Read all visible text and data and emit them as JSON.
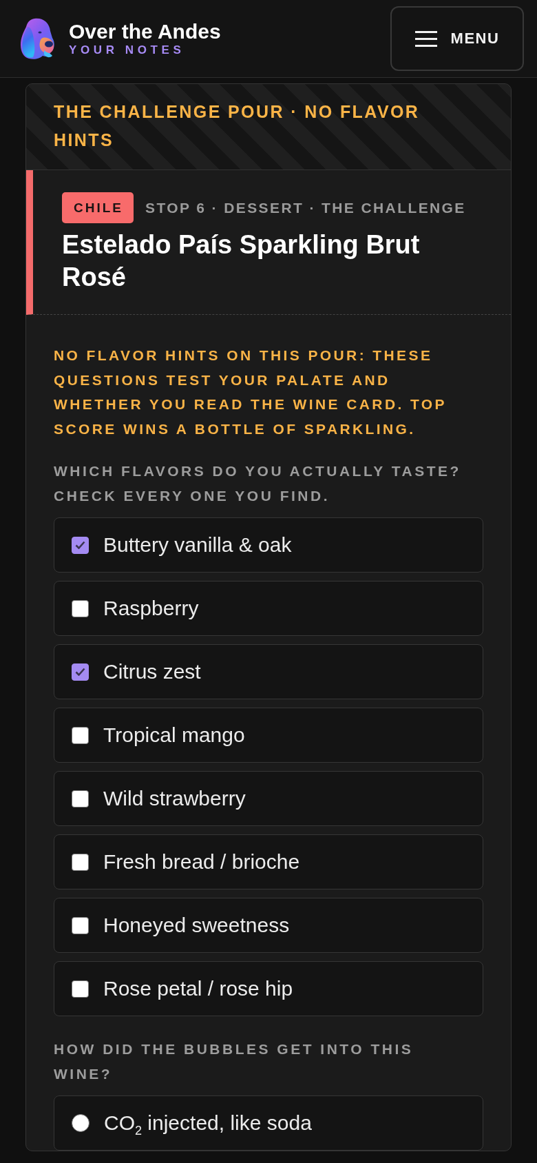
{
  "header": {
    "title": "Over the Andes",
    "subtitle": "YOUR NOTES",
    "menu_button": {
      "label": "MENU"
    }
  },
  "card": {
    "banner": "THE CHALLENGE POUR · NO FLAVOR HINTS",
    "wine": {
      "country": "CHILE",
      "meta": "STOP 6 · DESSERT · THE CHALLENGE",
      "name": "Estelado País Sparkling Brut Rosé"
    },
    "notice": "NO FLAVOR HINTS ON THIS POUR: THESE QUESTIONS TEST YOUR PALATE AND WHETHER YOU READ THE WINE CARD. TOP SCORE WINS A BOTTLE OF SPARKLING.",
    "questions": [
      {
        "kind": "checkbox",
        "prompt": "WHICH FLAVORS DO YOU ACTUALLY TASTE? CHECK EVERY ONE YOU FIND.",
        "options": [
          {
            "label": "Buttery vanilla & oak",
            "checked": true
          },
          {
            "label": "Raspberry",
            "checked": false
          },
          {
            "label": "Citrus zest",
            "checked": true
          },
          {
            "label": "Tropical mango",
            "checked": false
          },
          {
            "label": "Wild strawberry",
            "checked": false
          },
          {
            "label": "Fresh bread / brioche",
            "checked": false
          },
          {
            "label": "Honeyed sweetness",
            "checked": false
          },
          {
            "label": "Rose petal / rose hip",
            "checked": false
          }
        ]
      },
      {
        "kind": "radio",
        "prompt": "HOW DID THE BUBBLES GET INTO THIS WINE?",
        "options": [
          {
            "label": "CO$_{2}$ injected, like soda",
            "selected": false
          }
        ]
      }
    ]
  }
}
